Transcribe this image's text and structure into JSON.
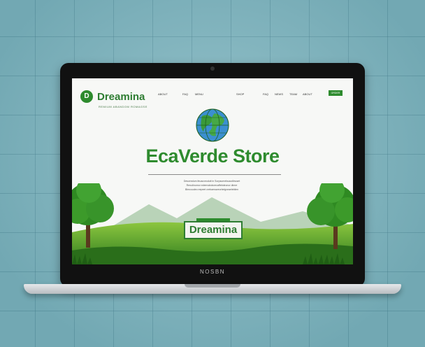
{
  "brand": {
    "logo_text": "Dreamina",
    "tagline": "REMIUM ABANDOM ROMAGSE",
    "badge_text": "Dreamina"
  },
  "nav": {
    "items": [
      "ABOUT",
      "FAQ",
      "MENU",
      "SHOP",
      "FAQ",
      "NEWS",
      "TEAM",
      "ABOUT"
    ],
    "cta": "ORDER NOW"
  },
  "hero": {
    "title": "EcaVerde Store",
    "description_lines": [
      "Descendum feuauveoduit in Sorpsurnebuaodlinuset",
      "Rerudinumor edeenobotcrecaffebdeonor dlmre",
      "Blrncoudeo eepeet crebaenaveorbelgveaeleblien"
    ]
  },
  "laptop": {
    "brand_label": "NOSBN"
  },
  "colors": {
    "accent_green": "#2e8b2e",
    "background": "#7fb6c0"
  }
}
